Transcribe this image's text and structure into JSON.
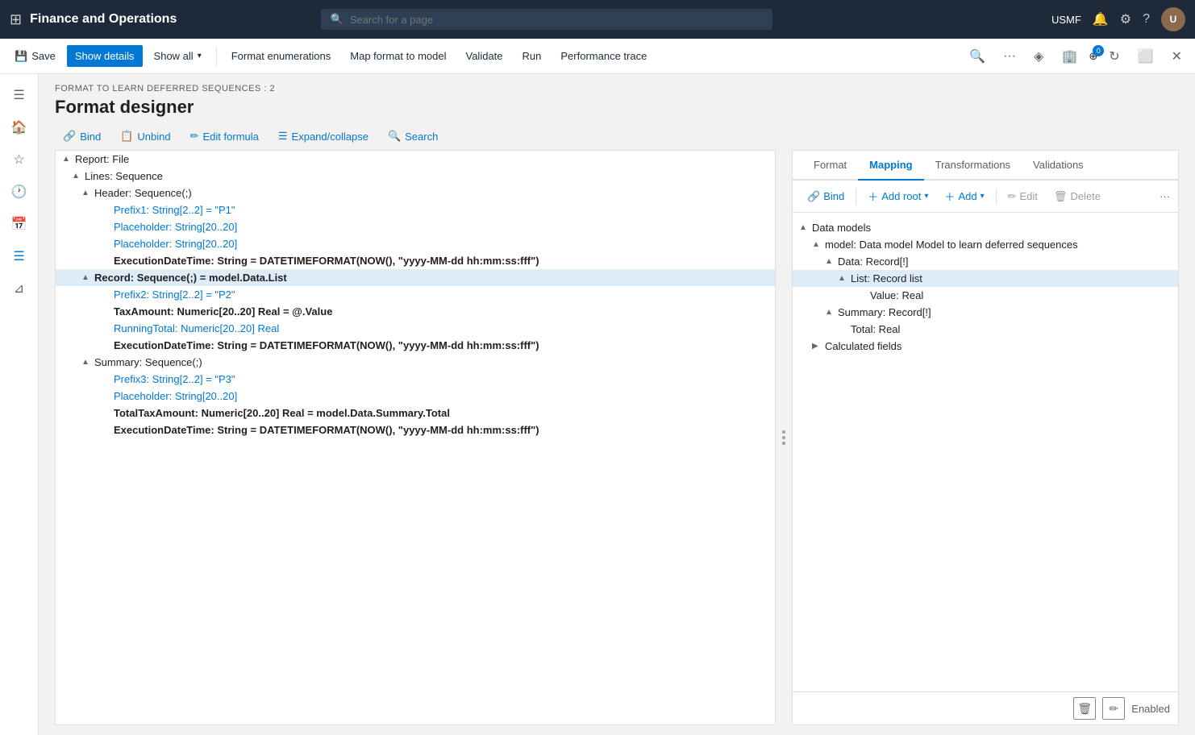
{
  "app": {
    "title": "Finance and Operations",
    "search_placeholder": "Search for a page",
    "user": "USMF",
    "notification_count": "0"
  },
  "toolbar": {
    "save_label": "Save",
    "show_details_label": "Show details",
    "show_all_label": "Show all",
    "format_enumerations_label": "Format enumerations",
    "map_format_label": "Map format to model",
    "validate_label": "Validate",
    "run_label": "Run",
    "performance_trace_label": "Performance trace"
  },
  "page": {
    "breadcrumb": "FORMAT TO LEARN DEFERRED SEQUENCES : 2",
    "title": "Format designer"
  },
  "sub_toolbar": {
    "bind_label": "Bind",
    "unbind_label": "Unbind",
    "edit_formula_label": "Edit formula",
    "expand_collapse_label": "Expand/collapse",
    "search_label": "Search"
  },
  "format_tree": {
    "nodes": [
      {
        "id": "report",
        "level": 0,
        "toggle": "▲",
        "text": "Report: File",
        "style": "normal"
      },
      {
        "id": "lines",
        "level": 1,
        "toggle": "▲",
        "text": "Lines: Sequence",
        "style": "normal"
      },
      {
        "id": "header",
        "level": 2,
        "toggle": "▲",
        "text": "Header: Sequence(;)",
        "style": "normal"
      },
      {
        "id": "prefix1",
        "level": 3,
        "toggle": "",
        "text": "Prefix1: String[2..2] = \"P1\"",
        "style": "unbound"
      },
      {
        "id": "placeholder1",
        "level": 3,
        "toggle": "",
        "text": "Placeholder: String[20..20]",
        "style": "unbound"
      },
      {
        "id": "placeholder2",
        "level": 3,
        "toggle": "",
        "text": "Placeholder: String[20..20]",
        "style": "unbound"
      },
      {
        "id": "execdate1",
        "level": 3,
        "toggle": "",
        "text": "ExecutionDateTime: String = DATETIMEFORMAT(NOW(), \"yyyy-MM-dd hh:mm:ss:fff\")",
        "style": "bound"
      },
      {
        "id": "record",
        "level": 2,
        "toggle": "▲",
        "text": "Record: Sequence(;) = model.Data.List",
        "style": "bound",
        "selected": true
      },
      {
        "id": "prefix2",
        "level": 3,
        "toggle": "",
        "text": "Prefix2: String[2..2] = \"P2\"",
        "style": "unbound"
      },
      {
        "id": "taxamount",
        "level": 3,
        "toggle": "",
        "text": "TaxAmount: Numeric[20..20] Real = @.Value",
        "style": "bound"
      },
      {
        "id": "runningtotal",
        "level": 3,
        "toggle": "",
        "text": "RunningTotal: Numeric[20..20] Real",
        "style": "unbound"
      },
      {
        "id": "execdate2",
        "level": 3,
        "toggle": "",
        "text": "ExecutionDateTime: String = DATETIMEFORMAT(NOW(), \"yyyy-MM-dd hh:mm:ss:fff\")",
        "style": "bound"
      },
      {
        "id": "summary",
        "level": 2,
        "toggle": "▲",
        "text": "Summary: Sequence(;)",
        "style": "normal"
      },
      {
        "id": "prefix3",
        "level": 3,
        "toggle": "",
        "text": "Prefix3: String[2..2] = \"P3\"",
        "style": "unbound"
      },
      {
        "id": "placeholder3",
        "level": 3,
        "toggle": "",
        "text": "Placeholder: String[20..20]",
        "style": "unbound"
      },
      {
        "id": "totaltax",
        "level": 3,
        "toggle": "",
        "text": "TotalTaxAmount: Numeric[20..20] Real = model.Data.Summary.Total",
        "style": "bound"
      },
      {
        "id": "execdate3",
        "level": 3,
        "toggle": "",
        "text": "ExecutionDateTime: String = DATETIMEFORMAT(NOW(), \"yyyy-MM-dd hh:mm:ss:fff\")",
        "style": "bound"
      }
    ]
  },
  "right_panel": {
    "tabs": [
      "Format",
      "Mapping",
      "Transformations",
      "Validations"
    ],
    "active_tab": "Mapping",
    "toolbar": {
      "bind_label": "Bind",
      "add_root_label": "Add root",
      "add_label": "Add",
      "edit_label": "Edit",
      "delete_label": "Delete"
    },
    "data_tree": {
      "nodes": [
        {
          "id": "data-models",
          "level": 0,
          "toggle": "▲",
          "text": "Data models",
          "style": "normal",
          "selected": false
        },
        {
          "id": "model",
          "level": 1,
          "toggle": "▲",
          "text": "model: Data model Model to learn deferred sequences",
          "style": "normal"
        },
        {
          "id": "data-record",
          "level": 2,
          "toggle": "▲",
          "text": "Data: Record[!]",
          "style": "normal"
        },
        {
          "id": "list",
          "level": 3,
          "toggle": "▲",
          "text": "List: Record list",
          "style": "normal",
          "selected": true
        },
        {
          "id": "value",
          "level": 4,
          "toggle": "",
          "text": "Value: Real",
          "style": "normal"
        },
        {
          "id": "summary-record",
          "level": 2,
          "toggle": "▲",
          "text": "Summary: Record[!]",
          "style": "normal"
        },
        {
          "id": "total",
          "level": 3,
          "toggle": "",
          "text": "Total: Real",
          "style": "normal"
        },
        {
          "id": "calc-fields",
          "level": 1,
          "toggle": "▶",
          "text": "Calculated fields",
          "style": "normal"
        }
      ]
    },
    "status": "Enabled"
  }
}
